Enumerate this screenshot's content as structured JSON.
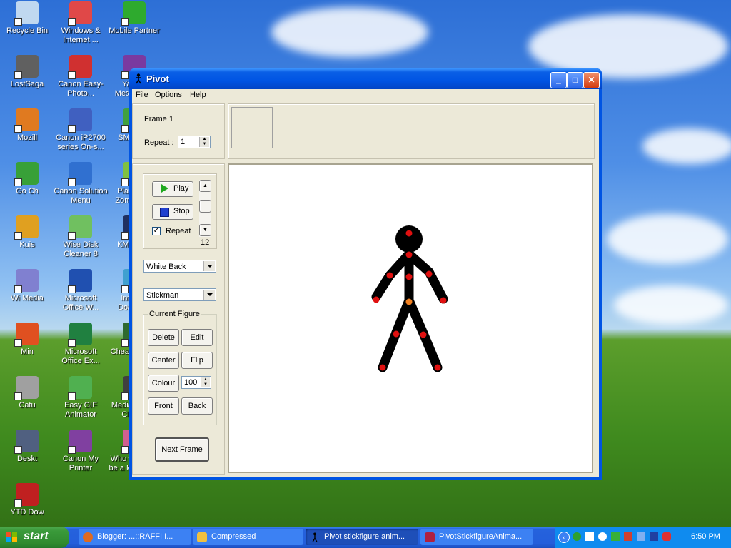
{
  "desktop": {
    "icons": [
      {
        "label": "Recycle Bin"
      },
      {
        "label": "Windows & Internet ..."
      },
      {
        "label": "Mobile Partner"
      },
      {
        "label": "LostSaga"
      },
      {
        "label": "Canon Easy-Photo..."
      },
      {
        "label": "Yahoo! Messenger"
      },
      {
        "label": "Mozill"
      },
      {
        "label": "Canon iP2700 series On-s..."
      },
      {
        "label": "SMADAV"
      },
      {
        "label": "Go Ch"
      },
      {
        "label": "Canon Solution Menu"
      },
      {
        "label": "Plants vs. Zombies™"
      },
      {
        "label": "Kuis"
      },
      {
        "label": "Wise Disk Cleaner 8"
      },
      {
        "label": "KMPlayer"
      },
      {
        "label": "Wi Media"
      },
      {
        "label": "Microsoft Office W..."
      },
      {
        "label": "Internet Downlo..."
      },
      {
        "label": "Min"
      },
      {
        "label": "Microsoft Office Ex..."
      },
      {
        "label": "Cheat Engine"
      },
      {
        "label": "Catu"
      },
      {
        "label": "Easy GIF Animator"
      },
      {
        "label": "Media Player Classic"
      },
      {
        "label": "Deskt"
      },
      {
        "label": "Canon My Printer"
      },
      {
        "label": "Who wants to be a Milliona..."
      },
      {
        "label": "YTD Dow"
      }
    ]
  },
  "window": {
    "title": "Pivot",
    "controls": {
      "minimize": "_",
      "maximize": "□",
      "close": "✕"
    },
    "menu": [
      "File",
      "Options",
      "Help"
    ],
    "frame_label": "Frame 1",
    "repeat_label": "Repeat :",
    "repeat_value": "1",
    "play_label": "Play",
    "stop_label": "Stop",
    "repeat_check_label": "Repeat",
    "repeat_checked": true,
    "speed_value": "12",
    "background_select": "White Back",
    "figure_select": "Stickman",
    "current_figure_label": "Current Figure",
    "buttons": {
      "delete": "Delete",
      "edit": "Edit",
      "center": "Center",
      "flip": "Flip",
      "colour": "Colour",
      "front": "Front",
      "back": "Back"
    },
    "colour_value": "100",
    "next_frame": "Next Frame"
  },
  "taskbar": {
    "start_label": "start",
    "tasks": [
      {
        "label": "Blogger: ...::RAFFI I...",
        "active": false
      },
      {
        "label": "Compressed",
        "active": false
      },
      {
        "label": "Pivot stickfigure anim...",
        "active": true
      },
      {
        "label": "PivotStickfigureAnima...",
        "active": false
      }
    ],
    "clock": "6:50 PM"
  },
  "colors": {
    "accent": "#0054e3",
    "stickman": "#000000",
    "joint": "#e01010",
    "center_joint": "#f08020"
  }
}
